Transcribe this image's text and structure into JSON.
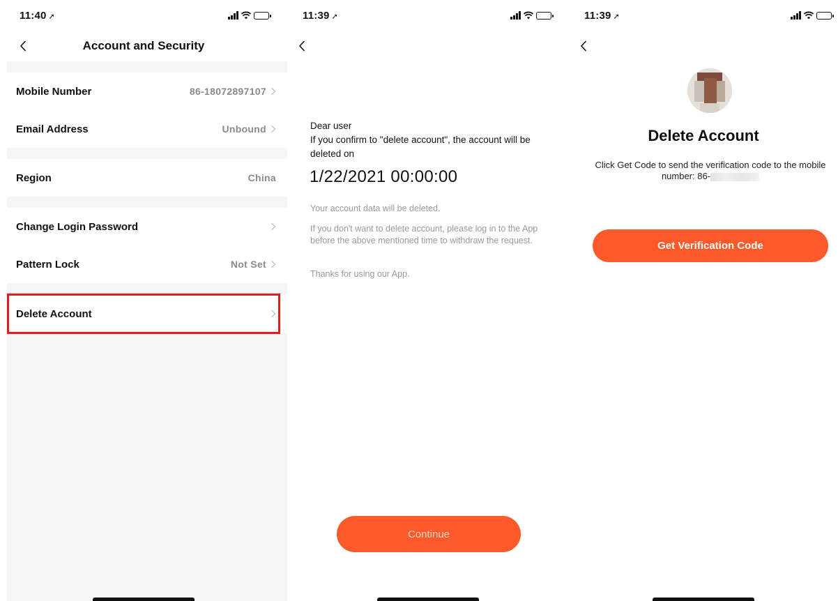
{
  "screens": [
    {
      "status": {
        "time": "11:40",
        "arrow": "➚"
      },
      "nav": {
        "title": "Account and Security"
      },
      "rows": [
        {
          "label": "Mobile Number",
          "value": "86-18072897107"
        },
        {
          "label": "Email Address",
          "value": "Unbound"
        },
        {
          "label": "Region",
          "value": "China"
        },
        {
          "label": "Change Login Password",
          "value": ""
        },
        {
          "label": "Pattern Lock",
          "value": "Not Set"
        },
        {
          "label": "Delete Account",
          "value": ""
        }
      ],
      "highlight_color": "#e31d1d"
    },
    {
      "status": {
        "time": "11:39",
        "arrow": "➚"
      },
      "greeting": "Dear user",
      "message": "If you confirm to \"delete account\", the account will be deleted on",
      "deletion_date": "1/22/2021 00:00:00",
      "notes": [
        "Your account data will be deleted.",
        "If you don't want to delete account, please log in to the App before the above mentioned time to withdraw the request.",
        "Thanks for using our App."
      ],
      "continue_label": "Continue"
    },
    {
      "status": {
        "time": "11:39",
        "arrow": "➚"
      },
      "title": "Delete Account",
      "message_prefix": "Click Get Code to send the verification code to the mobile number: 86-",
      "button_label": "Get Verification Code"
    }
  ],
  "accent_color": "#fc5a2a",
  "icons": [
    "back-chevron-icon",
    "right-chevron-icon",
    "signal-icon",
    "wifi-icon",
    "battery-icon",
    "location-arrow-icon"
  ]
}
